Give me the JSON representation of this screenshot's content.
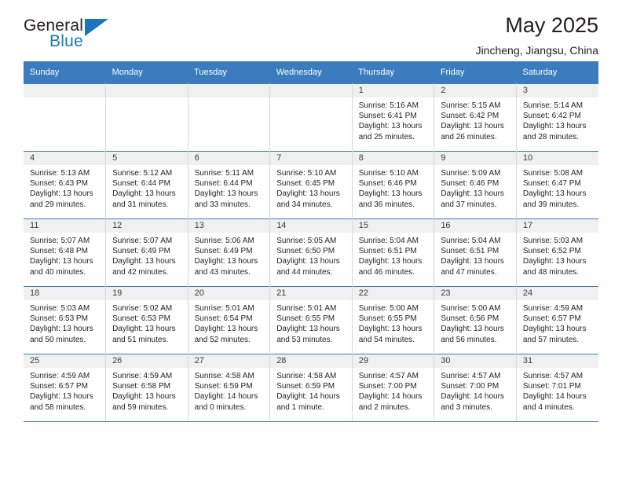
{
  "brand": {
    "name_part1": "General",
    "name_part2": "Blue",
    "logo_icon": "triangle-logo-icon",
    "accent_color": "#1b75bb"
  },
  "header": {
    "month_title": "May 2025",
    "location": "Jincheng, Jiangsu, China"
  },
  "calendar": {
    "header_color": "#3a7cbe",
    "weekday_headers": [
      "Sunday",
      "Monday",
      "Tuesday",
      "Wednesday",
      "Thursday",
      "Friday",
      "Saturday"
    ],
    "weeks": [
      [
        {
          "day": "",
          "sunrise": "",
          "sunset": "",
          "daylight_line1": "",
          "daylight_line2": "",
          "empty": true
        },
        {
          "day": "",
          "sunrise": "",
          "sunset": "",
          "daylight_line1": "",
          "daylight_line2": "",
          "empty": true
        },
        {
          "day": "",
          "sunrise": "",
          "sunset": "",
          "daylight_line1": "",
          "daylight_line2": "",
          "empty": true
        },
        {
          "day": "",
          "sunrise": "",
          "sunset": "",
          "daylight_line1": "",
          "daylight_line2": "",
          "empty": true
        },
        {
          "day": "1",
          "sunrise": "Sunrise: 5:16 AM",
          "sunset": "Sunset: 6:41 PM",
          "daylight_line1": "Daylight: 13 hours",
          "daylight_line2": "and 25 minutes."
        },
        {
          "day": "2",
          "sunrise": "Sunrise: 5:15 AM",
          "sunset": "Sunset: 6:42 PM",
          "daylight_line1": "Daylight: 13 hours",
          "daylight_line2": "and 26 minutes."
        },
        {
          "day": "3",
          "sunrise": "Sunrise: 5:14 AM",
          "sunset": "Sunset: 6:42 PM",
          "daylight_line1": "Daylight: 13 hours",
          "daylight_line2": "and 28 minutes."
        }
      ],
      [
        {
          "day": "4",
          "sunrise": "Sunrise: 5:13 AM",
          "sunset": "Sunset: 6:43 PM",
          "daylight_line1": "Daylight: 13 hours",
          "daylight_line2": "and 29 minutes."
        },
        {
          "day": "5",
          "sunrise": "Sunrise: 5:12 AM",
          "sunset": "Sunset: 6:44 PM",
          "daylight_line1": "Daylight: 13 hours",
          "daylight_line2": "and 31 minutes."
        },
        {
          "day": "6",
          "sunrise": "Sunrise: 5:11 AM",
          "sunset": "Sunset: 6:44 PM",
          "daylight_line1": "Daylight: 13 hours",
          "daylight_line2": "and 33 minutes."
        },
        {
          "day": "7",
          "sunrise": "Sunrise: 5:10 AM",
          "sunset": "Sunset: 6:45 PM",
          "daylight_line1": "Daylight: 13 hours",
          "daylight_line2": "and 34 minutes."
        },
        {
          "day": "8",
          "sunrise": "Sunrise: 5:10 AM",
          "sunset": "Sunset: 6:46 PM",
          "daylight_line1": "Daylight: 13 hours",
          "daylight_line2": "and 36 minutes."
        },
        {
          "day": "9",
          "sunrise": "Sunrise: 5:09 AM",
          "sunset": "Sunset: 6:46 PM",
          "daylight_line1": "Daylight: 13 hours",
          "daylight_line2": "and 37 minutes."
        },
        {
          "day": "10",
          "sunrise": "Sunrise: 5:08 AM",
          "sunset": "Sunset: 6:47 PM",
          "daylight_line1": "Daylight: 13 hours",
          "daylight_line2": "and 39 minutes."
        }
      ],
      [
        {
          "day": "11",
          "sunrise": "Sunrise: 5:07 AM",
          "sunset": "Sunset: 6:48 PM",
          "daylight_line1": "Daylight: 13 hours",
          "daylight_line2": "and 40 minutes."
        },
        {
          "day": "12",
          "sunrise": "Sunrise: 5:07 AM",
          "sunset": "Sunset: 6:49 PM",
          "daylight_line1": "Daylight: 13 hours",
          "daylight_line2": "and 42 minutes."
        },
        {
          "day": "13",
          "sunrise": "Sunrise: 5:06 AM",
          "sunset": "Sunset: 6:49 PM",
          "daylight_line1": "Daylight: 13 hours",
          "daylight_line2": "and 43 minutes."
        },
        {
          "day": "14",
          "sunrise": "Sunrise: 5:05 AM",
          "sunset": "Sunset: 6:50 PM",
          "daylight_line1": "Daylight: 13 hours",
          "daylight_line2": "and 44 minutes."
        },
        {
          "day": "15",
          "sunrise": "Sunrise: 5:04 AM",
          "sunset": "Sunset: 6:51 PM",
          "daylight_line1": "Daylight: 13 hours",
          "daylight_line2": "and 46 minutes."
        },
        {
          "day": "16",
          "sunrise": "Sunrise: 5:04 AM",
          "sunset": "Sunset: 6:51 PM",
          "daylight_line1": "Daylight: 13 hours",
          "daylight_line2": "and 47 minutes."
        },
        {
          "day": "17",
          "sunrise": "Sunrise: 5:03 AM",
          "sunset": "Sunset: 6:52 PM",
          "daylight_line1": "Daylight: 13 hours",
          "daylight_line2": "and 48 minutes."
        }
      ],
      [
        {
          "day": "18",
          "sunrise": "Sunrise: 5:03 AM",
          "sunset": "Sunset: 6:53 PM",
          "daylight_line1": "Daylight: 13 hours",
          "daylight_line2": "and 50 minutes."
        },
        {
          "day": "19",
          "sunrise": "Sunrise: 5:02 AM",
          "sunset": "Sunset: 6:53 PM",
          "daylight_line1": "Daylight: 13 hours",
          "daylight_line2": "and 51 minutes."
        },
        {
          "day": "20",
          "sunrise": "Sunrise: 5:01 AM",
          "sunset": "Sunset: 6:54 PM",
          "daylight_line1": "Daylight: 13 hours",
          "daylight_line2": "and 52 minutes."
        },
        {
          "day": "21",
          "sunrise": "Sunrise: 5:01 AM",
          "sunset": "Sunset: 6:55 PM",
          "daylight_line1": "Daylight: 13 hours",
          "daylight_line2": "and 53 minutes."
        },
        {
          "day": "22",
          "sunrise": "Sunrise: 5:00 AM",
          "sunset": "Sunset: 6:55 PM",
          "daylight_line1": "Daylight: 13 hours",
          "daylight_line2": "and 54 minutes."
        },
        {
          "day": "23",
          "sunrise": "Sunrise: 5:00 AM",
          "sunset": "Sunset: 6:56 PM",
          "daylight_line1": "Daylight: 13 hours",
          "daylight_line2": "and 56 minutes."
        },
        {
          "day": "24",
          "sunrise": "Sunrise: 4:59 AM",
          "sunset": "Sunset: 6:57 PM",
          "daylight_line1": "Daylight: 13 hours",
          "daylight_line2": "and 57 minutes."
        }
      ],
      [
        {
          "day": "25",
          "sunrise": "Sunrise: 4:59 AM",
          "sunset": "Sunset: 6:57 PM",
          "daylight_line1": "Daylight: 13 hours",
          "daylight_line2": "and 58 minutes."
        },
        {
          "day": "26",
          "sunrise": "Sunrise: 4:59 AM",
          "sunset": "Sunset: 6:58 PM",
          "daylight_line1": "Daylight: 13 hours",
          "daylight_line2": "and 59 minutes."
        },
        {
          "day": "27",
          "sunrise": "Sunrise: 4:58 AM",
          "sunset": "Sunset: 6:59 PM",
          "daylight_line1": "Daylight: 14 hours",
          "daylight_line2": "and 0 minutes."
        },
        {
          "day": "28",
          "sunrise": "Sunrise: 4:58 AM",
          "sunset": "Sunset: 6:59 PM",
          "daylight_line1": "Daylight: 14 hours",
          "daylight_line2": "and 1 minute."
        },
        {
          "day": "29",
          "sunrise": "Sunrise: 4:57 AM",
          "sunset": "Sunset: 7:00 PM",
          "daylight_line1": "Daylight: 14 hours",
          "daylight_line2": "and 2 minutes."
        },
        {
          "day": "30",
          "sunrise": "Sunrise: 4:57 AM",
          "sunset": "Sunset: 7:00 PM",
          "daylight_line1": "Daylight: 14 hours",
          "daylight_line2": "and 3 minutes."
        },
        {
          "day": "31",
          "sunrise": "Sunrise: 4:57 AM",
          "sunset": "Sunset: 7:01 PM",
          "daylight_line1": "Daylight: 14 hours",
          "daylight_line2": "and 4 minutes."
        }
      ]
    ]
  }
}
